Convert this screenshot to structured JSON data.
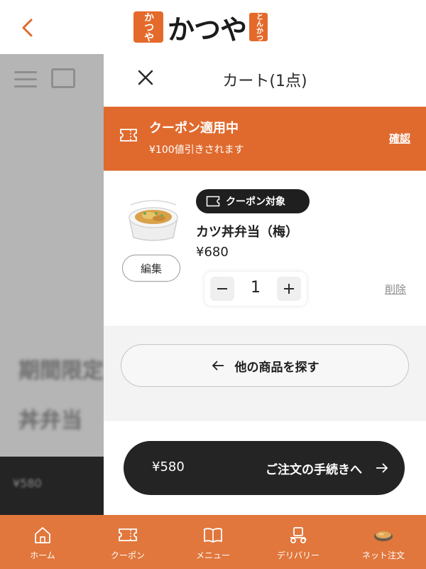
{
  "header": {
    "logo_text": "かつや",
    "logo_seal": "かつや",
    "logo_tag": "とんかつ"
  },
  "background_page": {
    "text_line1": "期間限定",
    "text_line2": "丼弁当",
    "price": "¥580"
  },
  "cart": {
    "title": "カート(1点)",
    "coupon_banner": {
      "title": "クーポン適用中",
      "subtitle": "¥100値引きされます",
      "confirm_label": "確認"
    },
    "item": {
      "coupon_tag": "クーポン対象",
      "name": "カツ丼弁当（梅）",
      "price": "¥680",
      "edit_label": "編集",
      "quantity": "1",
      "delete_label": "削除"
    },
    "browse_label": "他の商品を探す",
    "checkout": {
      "total": "¥580",
      "label": "ご注文の手続きへ"
    }
  },
  "bottom_nav": {
    "items": [
      {
        "label": "ホーム",
        "icon": "home-icon"
      },
      {
        "label": "クーポン",
        "icon": "coupon-icon"
      },
      {
        "label": "メニュー",
        "icon": "menu-book-icon"
      },
      {
        "label": "デリバリー",
        "icon": "delivery-icon"
      },
      {
        "label": "ネット注文",
        "icon": "online-order-icon"
      }
    ]
  },
  "colors": {
    "accent": "#e06a2e",
    "nav": "#e1773c",
    "dark": "#242424"
  }
}
